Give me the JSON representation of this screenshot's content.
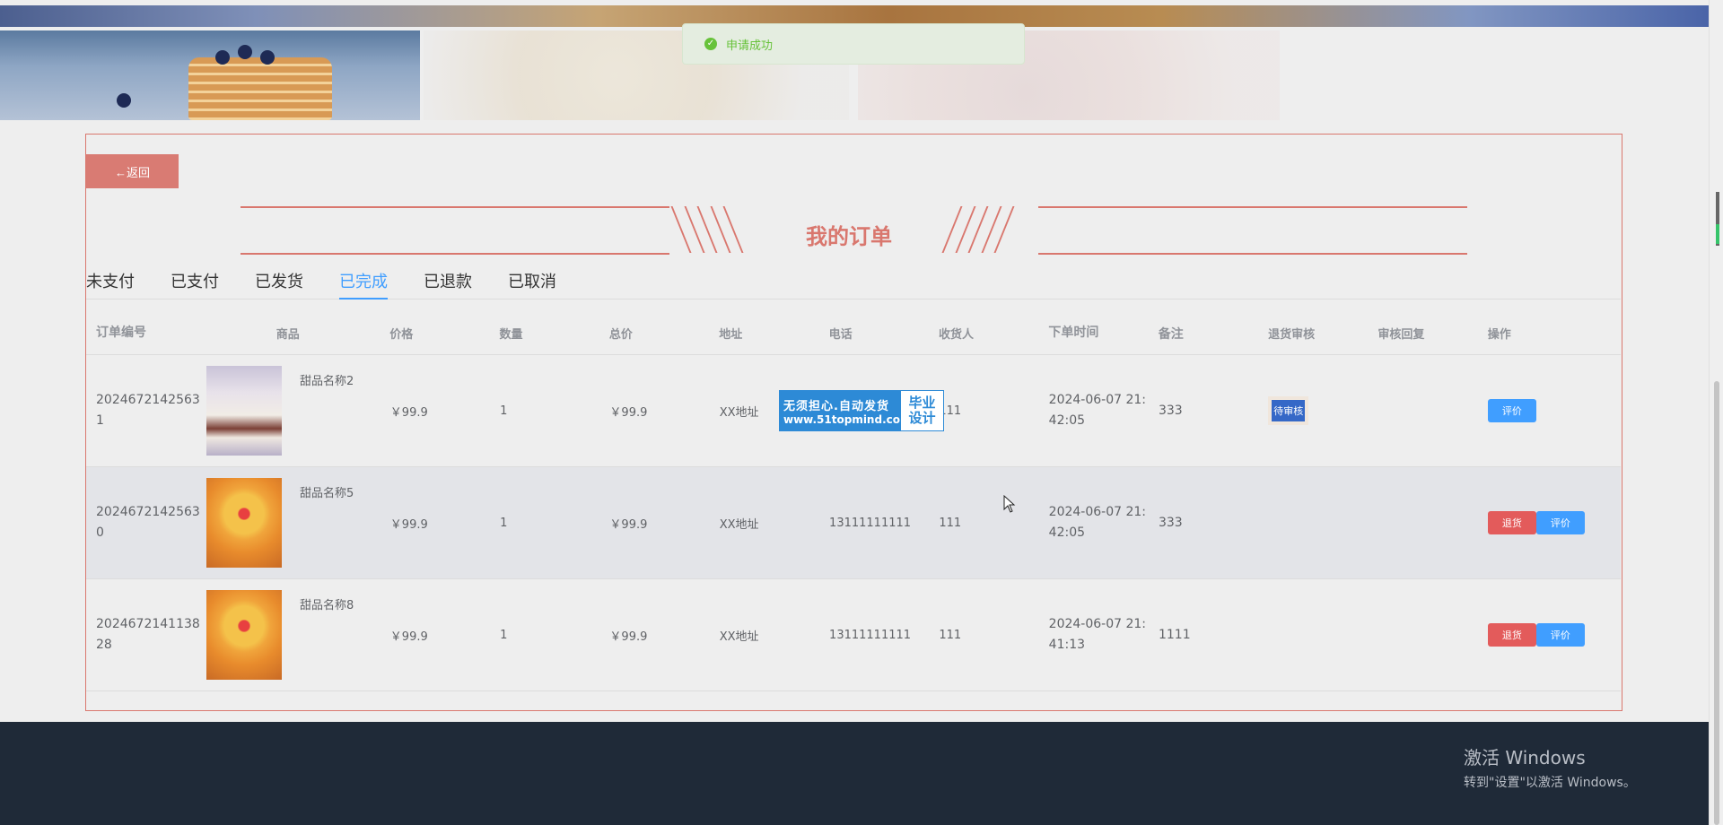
{
  "toast": {
    "message": "申请成功"
  },
  "back_label": "←返回",
  "page_title": "我的订单",
  "tabs": [
    {
      "label": "未支付",
      "active": false
    },
    {
      "label": "已支付",
      "active": false
    },
    {
      "label": "已发货",
      "active": false
    },
    {
      "label": "已完成",
      "active": true
    },
    {
      "label": "已退款",
      "active": false
    },
    {
      "label": "已取消",
      "active": false
    }
  ],
  "table": {
    "headers": [
      "订单编号",
      "商品",
      "价格",
      "数量",
      "总价",
      "地址",
      "电话",
      "收货人",
      "下单时间",
      "备注",
      "退货审核",
      "审核回复",
      "操作"
    ],
    "rows": [
      {
        "id_line1": "2024672142563",
        "id_line2": "1",
        "goods_name": "甜品名称2",
        "image": "cake-slice",
        "price": "￥99.9",
        "qty": "1",
        "total": "￥99.9",
        "address": "XX地址",
        "phone": "",
        "receiver": "111",
        "time_line1": "2024-06-07 21:",
        "time_line2": "42:05",
        "remark": "333",
        "audit": "待审核",
        "reply": "",
        "actions": [
          "评价"
        ]
      },
      {
        "id_line1": "2024672142563",
        "id_line2": "0",
        "goods_name": "甜品名称5",
        "image": "fruit-tart",
        "price": "￥99.9",
        "qty": "1",
        "total": "￥99.9",
        "address": "XX地址",
        "phone": "13111111111",
        "receiver": "111",
        "time_line1": "2024-06-07 21:",
        "time_line2": "42:05",
        "remark": "333",
        "audit": "",
        "reply": "",
        "actions": [
          "退货",
          "评价"
        ]
      },
      {
        "id_line1": "2024672141138",
        "id_line2": "28",
        "goods_name": "甜品名称8",
        "image": "fruit-tart",
        "price": "￥99.9",
        "qty": "1",
        "total": "￥99.9",
        "address": "XX地址",
        "phone": "13111111111",
        "receiver": "111",
        "time_line1": "2024-06-07 21:",
        "time_line2": "41:13",
        "remark": "1111",
        "audit": "",
        "reply": "",
        "actions": [
          "退货",
          "评价"
        ]
      }
    ]
  },
  "watermark": {
    "line1": "无须担心.自动发货",
    "line2": "www.51topmind.com",
    "right_line1": "毕业",
    "right_line2": "设计"
  },
  "windows_activation": {
    "title": "激活 Windows",
    "subtitle": "转到\"设置\"以激活 Windows。"
  },
  "colors": {
    "accent": "#d9776e",
    "primary": "#409eff",
    "danger": "#e35b5b",
    "success": "#67c23a",
    "footer": "#1f2a38"
  }
}
